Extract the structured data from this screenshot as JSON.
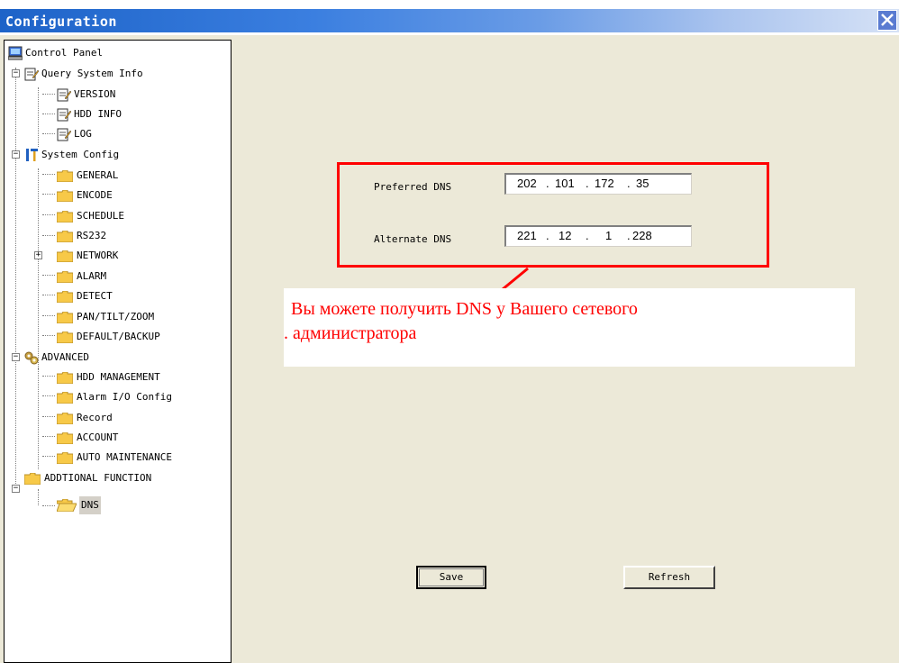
{
  "window": {
    "title": "Configuration"
  },
  "tree": {
    "root": "Control Panel",
    "query_system_info": "Query System Info",
    "version": "VERSION",
    "hdd_info": "HDD INFO",
    "log": "LOG",
    "system_config": "System Config",
    "general": "GENERAL",
    "encode": "ENCODE",
    "schedule": "SCHEDULE",
    "rs232": "RS232",
    "network": "NETWORK",
    "alarm": "ALARM",
    "detect": "DETECT",
    "pan_tilt_zoom": "PAN/TILT/ZOOM",
    "default_backup": "DEFAULT/BACKUP",
    "advanced": "ADVANCED",
    "hdd_management": "HDD MANAGEMENT",
    "alarm_io_config": "Alarm I/O Config",
    "record": "Record",
    "account": "ACCOUNT",
    "auto_maintenance": "AUTO MAINTENANCE",
    "additional_function": "ADDTIONAL FUNCTION",
    "dns": "DNS"
  },
  "dns_form": {
    "preferred_label": "Preferred DNS",
    "preferred": [
      "202",
      "101",
      "172",
      "35"
    ],
    "alternate_label": "Alternate DNS",
    "alternate": [
      "221",
      "12",
      "1",
      "228"
    ]
  },
  "callout": {
    "line1": "Вы можете получить DNS у Вашего сетевого",
    "line2": ". администратора"
  },
  "buttons": {
    "save": "Save",
    "refresh": "Refresh"
  },
  "colors": {
    "accent": "#1d63c8",
    "highlight": "#ff0000",
    "background": "#ece9d8"
  }
}
